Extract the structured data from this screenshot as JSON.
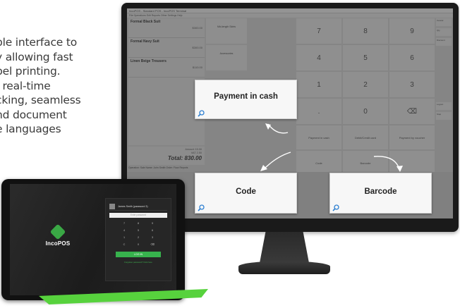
{
  "intro_lines": [
    "ble interface to",
    "y allowing fast",
    "bel printing.",
    ", real-time",
    "cking, seamless",
    "nd document",
    "e languages"
  ],
  "pos": {
    "titlebar": "IncoPOS - Standard POS - IncoPOS Terminal",
    "menubar": "File  Operations  Edit  Reports  Other  Settings  Help",
    "items": [
      {
        "name": "Formal Black Suit",
        "price": "$300.00"
      },
      {
        "name": "Formal Navy Suit",
        "price": "$300.00"
      },
      {
        "name": "Linen Beige Trousers",
        "price": "$110.00"
      }
    ],
    "categories": [
      "Mid-length Skirts",
      "Accessories"
    ],
    "keypad": [
      "7",
      "8",
      "9",
      "4",
      "5",
      "6",
      "1",
      "2",
      "3",
      ".",
      "0",
      "⌫"
    ],
    "payment_keys": [
      "Payment in cash",
      "Debit/Credit card",
      "Payment by voucher"
    ],
    "code_key": "Code",
    "barcode_key": "Barcode",
    "side_buttons": [
      "Cancel",
      "Qty",
      "Discount",
      "Logout",
      "Stop"
    ],
    "totals": {
      "amount": "Amount   15.00",
      "vat": "VAT   2.50",
      "total": "Total: 830.00"
    },
    "bottom_bar": "Operation: Sale  Name: John Smith  Order: Floor  Reports"
  },
  "callouts": {
    "payment": "Payment in cash",
    "code": "Code",
    "barcode": "Barcode"
  },
  "tablet": {
    "brand": "IncoPOS",
    "user": "James Smith (password 3)",
    "password_placeholder": "Enter password",
    "pad": [
      "7",
      "8",
      "9",
      "4",
      "5",
      "6",
      "1",
      "2",
      "3",
      "C",
      "0",
      "⌫"
    ],
    "login_label": "LOG IN",
    "forgot": "Forgotten password? Click here"
  },
  "colors": {
    "brand_green": "#3aa845",
    "bezel": "#1a1a1a"
  }
}
